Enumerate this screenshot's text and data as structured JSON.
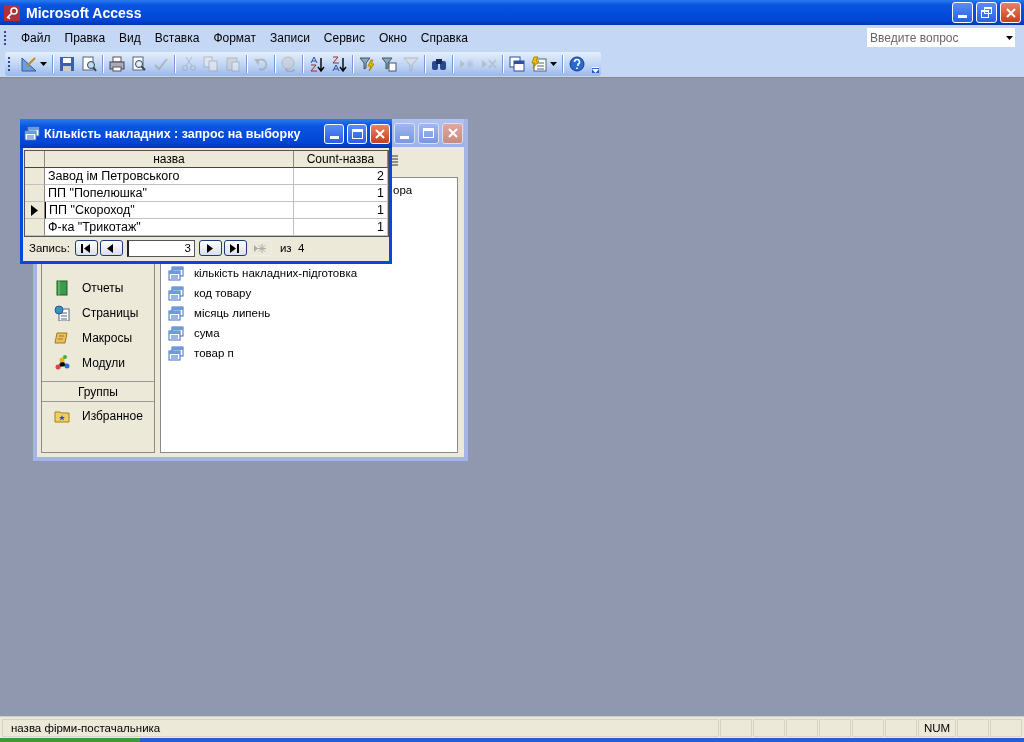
{
  "window": {
    "title": "Microsoft Access"
  },
  "menu": [
    "Файл",
    "Правка",
    "Вид",
    "Вставка",
    "Формат",
    "Записи",
    "Сервис",
    "Окно",
    "Справка"
  ],
  "help_box": {
    "placeholder": "Введите вопрос"
  },
  "toolbar": [
    {
      "kind": "design",
      "disabled": false
    },
    {
      "kind": "separator"
    },
    {
      "kind": "save",
      "disabled": false
    },
    {
      "kind": "search",
      "disabled": false
    },
    {
      "kind": "separator"
    },
    {
      "kind": "print",
      "disabled": false
    },
    {
      "kind": "preview",
      "disabled": false
    },
    {
      "kind": "spell",
      "disabled": true
    },
    {
      "kind": "separator"
    },
    {
      "kind": "cut",
      "disabled": true
    },
    {
      "kind": "copy",
      "disabled": true
    },
    {
      "kind": "paste",
      "disabled": true
    },
    {
      "kind": "separator"
    },
    {
      "kind": "undo",
      "disabled": true
    },
    {
      "kind": "separator"
    },
    {
      "kind": "link",
      "disabled": true
    },
    {
      "kind": "separator"
    },
    {
      "kind": "sort-asc",
      "disabled": false
    },
    {
      "kind": "sort-desc",
      "disabled": false
    },
    {
      "kind": "separator"
    },
    {
      "kind": "filter-sel",
      "disabled": false
    },
    {
      "kind": "filter-form",
      "disabled": false
    },
    {
      "kind": "filter",
      "disabled": true
    },
    {
      "kind": "separator"
    },
    {
      "kind": "find",
      "disabled": false
    },
    {
      "kind": "separator"
    },
    {
      "kind": "new-record",
      "disabled": true
    },
    {
      "kind": "delete-record",
      "disabled": true
    },
    {
      "kind": "separator"
    },
    {
      "kind": "db-window",
      "disabled": false
    },
    {
      "kind": "new-object",
      "disabled": false
    },
    {
      "kind": "separator"
    },
    {
      "kind": "help",
      "disabled": false
    }
  ],
  "database_window": {
    "objects": [
      {
        "label": "Отчеты",
        "kind": "reports"
      },
      {
        "label": "Страницы",
        "kind": "pages"
      },
      {
        "label": "Макросы",
        "kind": "macros"
      },
      {
        "label": "Модули",
        "kind": "modules"
      }
    ],
    "groups_header": "Группы",
    "groups": [
      {
        "label": "Избранное",
        "kind": "favorites"
      }
    ],
    "items": [
      {
        "label": "ора",
        "partial": true
      },
      {
        "label": "кількість накладних-підготовка",
        "partial": false
      },
      {
        "label": "код товару",
        "partial": false
      },
      {
        "label": "місяць липень",
        "partial": false
      },
      {
        "label": "сума",
        "partial": false
      },
      {
        "label": "товар п",
        "partial": false
      }
    ]
  },
  "query_window": {
    "title": "Кількість накладних : запрос на выборку",
    "columns": [
      "назва",
      "Count-назва"
    ],
    "rows": [
      {
        "cells": [
          "Завод ім Петровського",
          "2"
        ],
        "current": false
      },
      {
        "cells": [
          "ПП \"Попелюшка\"",
          "1"
        ],
        "current": false
      },
      {
        "cells": [
          "ПП \"Скороход\"",
          "1"
        ],
        "current": true
      },
      {
        "cells": [
          "Ф-ка \"Трикотаж\"",
          "1"
        ],
        "current": false
      }
    ],
    "navigation": {
      "label": "Запись:",
      "record": "3",
      "total": "из  4",
      "buttons": [
        {
          "kind": "first",
          "disabled": false
        },
        {
          "kind": "prev",
          "disabled": false
        },
        {
          "kind": "field"
        },
        {
          "kind": "next",
          "disabled": false
        },
        {
          "kind": "last",
          "disabled": false
        },
        {
          "kind": "new",
          "disabled": true
        }
      ]
    }
  },
  "status_bar": {
    "text": "назва фірми-постачальника",
    "indicators": [
      "NUM"
    ]
  }
}
